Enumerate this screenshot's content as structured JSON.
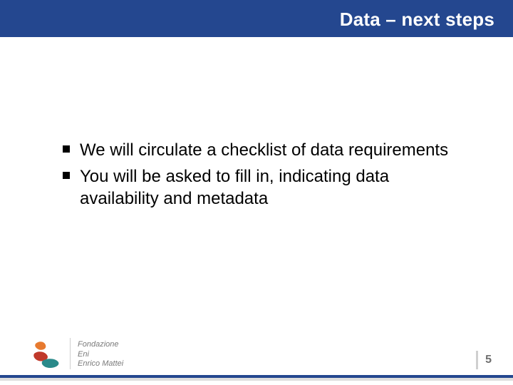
{
  "title": "Data – next steps",
  "bullets": [
    "We will circulate a checklist of data requirements",
    "You will be asked to fill in, indicating data availability and metadata"
  ],
  "logo": {
    "line1": "Fondazione",
    "line2": "Eni",
    "line3": "Enrico Mattei"
  },
  "page_number": "5",
  "colors": {
    "brand_blue": "#24478f",
    "logo_orange": "#e77a2f",
    "logo_red": "#c0392b",
    "logo_teal": "#2a8a8a"
  }
}
